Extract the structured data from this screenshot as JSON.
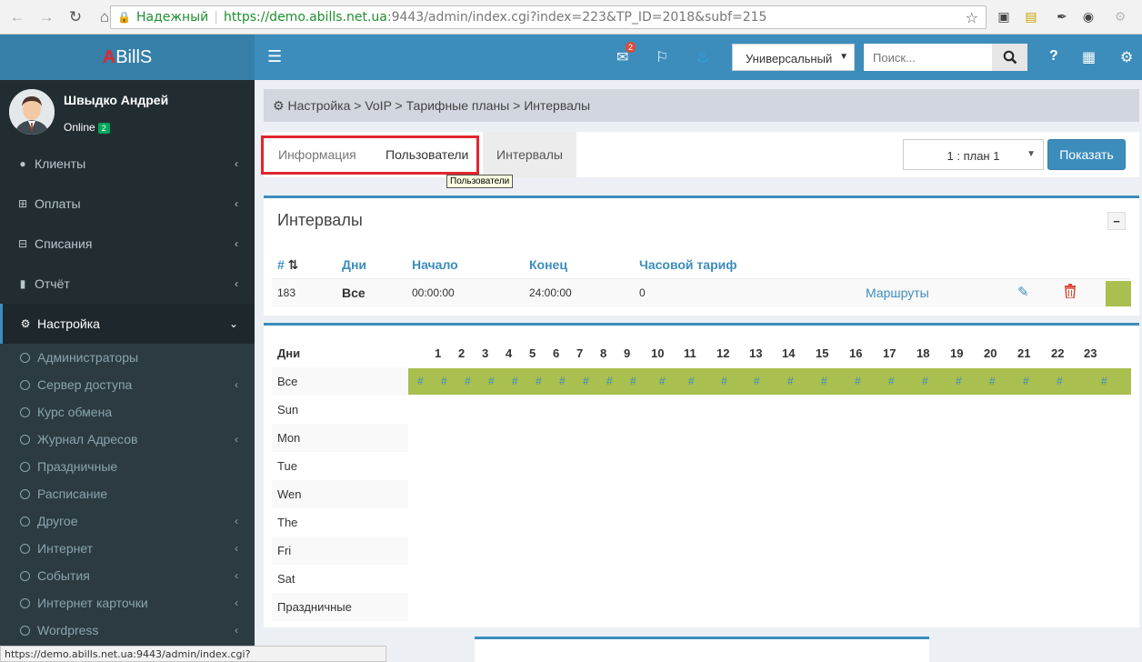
{
  "browser": {
    "secure_label": "Надежный",
    "url_scheme_host": "https://demo.abills.net.ua",
    "url_rest": ":9443/admin/index.cgi?index=223&TP_ID=2018&subf=215",
    "status_url": "https://demo.abills.net.ua:9443/admin/index.cgi?index=223&TP_ID=2018&subf=215"
  },
  "app": {
    "logo_a": "A",
    "logo_rest": "BillS"
  },
  "topbar": {
    "mail_badge": "2",
    "mode_select": "Универсальный",
    "search_placeholder": "Поиск..."
  },
  "user": {
    "name": "Швыдко Андрей",
    "status": "Online",
    "status_badge": "2"
  },
  "sidebar": {
    "items": [
      {
        "label": "Клиенты",
        "icon": "user-icon"
      },
      {
        "label": "Оплаты",
        "icon": "plus-square-icon"
      },
      {
        "label": "Списания",
        "icon": "minus-square-icon"
      },
      {
        "label": "Отчёт",
        "icon": "bar-chart-icon"
      },
      {
        "label": "Настройка",
        "icon": "gear-icon"
      }
    ],
    "subitems": [
      "Администраторы",
      "Сервер доступа",
      "Курс обмена",
      "Журнал Адресов",
      "Праздничные",
      "Расписание",
      "Другое",
      "Интернет",
      "События",
      "Интернет карточки",
      "Wordpress"
    ]
  },
  "breadcrumb": "Настройка > VoIP > Тарифные планы > Интервалы",
  "tabs": {
    "info": "Информация",
    "users": "Пользователи",
    "intervals": "Интервалы",
    "tooltip": "Пользователи"
  },
  "plan_select": "1 : план 1",
  "show_button": "Показать",
  "intervals_box": {
    "title": "Интервалы",
    "collapse": "−",
    "headers": {
      "num": "#",
      "days": "Дни",
      "start": "Начало",
      "end": "Конец",
      "tariff": "Часовой тариф"
    },
    "row": {
      "id": "183",
      "days": "Все",
      "start": "00:00:00",
      "end": "24:00:00",
      "tariff": "0",
      "routes": "Маршруты"
    }
  },
  "schedule": {
    "header": "Дни",
    "hours": [
      "1",
      "2",
      "3",
      "4",
      "5",
      "6",
      "7",
      "8",
      "9",
      "10",
      "11",
      "12",
      "13",
      "14",
      "15",
      "16",
      "17",
      "18",
      "19",
      "20",
      "21",
      "22",
      "23"
    ],
    "days": [
      "Все",
      "Sun",
      "Mon",
      "Tue",
      "Wen",
      "The",
      "Fri",
      "Sat",
      "Праздничные"
    ],
    "hash": "#"
  },
  "colors": {
    "accent": "#3c8dbc",
    "sidebar": "#222d32",
    "interval_green": "#a9bf4f",
    "highlight": "#e0262c"
  }
}
